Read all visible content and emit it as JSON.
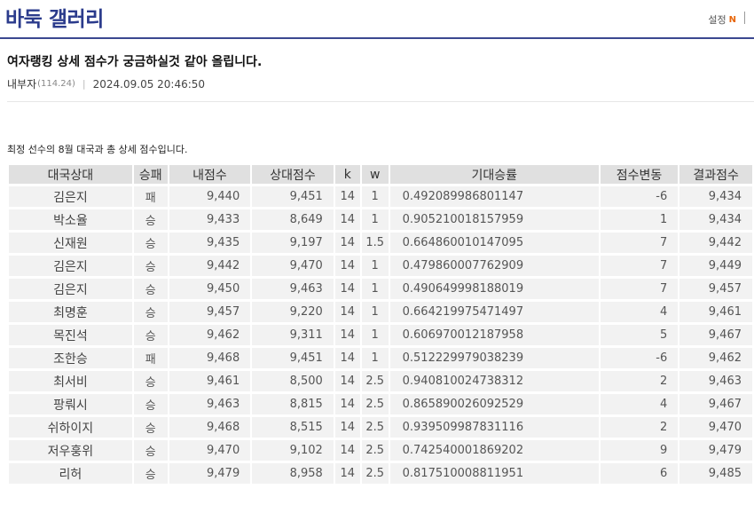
{
  "header": {
    "gallery_title": "바둑 갤러리",
    "settings_label": "설정",
    "settings_badge": "N"
  },
  "post": {
    "title": "여자랭킹 상세 점수가 궁금하실것 같아 올립니다.",
    "author": "내부자",
    "ip": "(114.24)",
    "date": "2024.09.05 20:46:50",
    "intro": "최정 선수의 8월 대국과 총 상세 점수입니다."
  },
  "table": {
    "headers": [
      "대국상대",
      "승패",
      "내점수",
      "상대점수",
      "k",
      "w",
      "기대승률",
      "점수변동",
      "결과점수"
    ],
    "rows": [
      [
        "김은지",
        "패",
        "9,440",
        "9,451",
        "14",
        "1",
        "0.492089986801147",
        "-6",
        "9,434"
      ],
      [
        "박소율",
        "승",
        "9,433",
        "8,649",
        "14",
        "1",
        "0.905210018157959",
        "1",
        "9,434"
      ],
      [
        "신재원",
        "승",
        "9,435",
        "9,197",
        "14",
        "1.5",
        "0.664860010147095",
        "7",
        "9,442"
      ],
      [
        "김은지",
        "승",
        "9,442",
        "9,470",
        "14",
        "1",
        "0.479860007762909",
        "7",
        "9,449"
      ],
      [
        "김은지",
        "승",
        "9,450",
        "9,463",
        "14",
        "1",
        "0.490649998188019",
        "7",
        "9,457"
      ],
      [
        "최명훈",
        "승",
        "9,457",
        "9,220",
        "14",
        "1",
        "0.664219975471497",
        "4",
        "9,461"
      ],
      [
        "목진석",
        "승",
        "9,462",
        "9,311",
        "14",
        "1",
        "0.606970012187958",
        "5",
        "9,467"
      ],
      [
        "조한승",
        "패",
        "9,468",
        "9,451",
        "14",
        "1",
        "0.512229979038239",
        "-6",
        "9,462"
      ],
      [
        "최서비",
        "승",
        "9,461",
        "8,500",
        "14",
        "2.5",
        "0.940810024738312",
        "2",
        "9,463"
      ],
      [
        "팡뤄시",
        "승",
        "9,463",
        "8,815",
        "14",
        "2.5",
        "0.865890026092529",
        "4",
        "9,467"
      ],
      [
        "쉬하이지",
        "승",
        "9,468",
        "8,515",
        "14",
        "2.5",
        "0.939509987831116",
        "2",
        "9,470"
      ],
      [
        "저우훙위",
        "승",
        "9,470",
        "9,102",
        "14",
        "2.5",
        "0.742540001869202",
        "9",
        "9,479"
      ],
      [
        "리허",
        "승",
        "9,479",
        "8,958",
        "14",
        "2.5",
        "0.817510008811951",
        "6",
        "9,485"
      ]
    ]
  }
}
